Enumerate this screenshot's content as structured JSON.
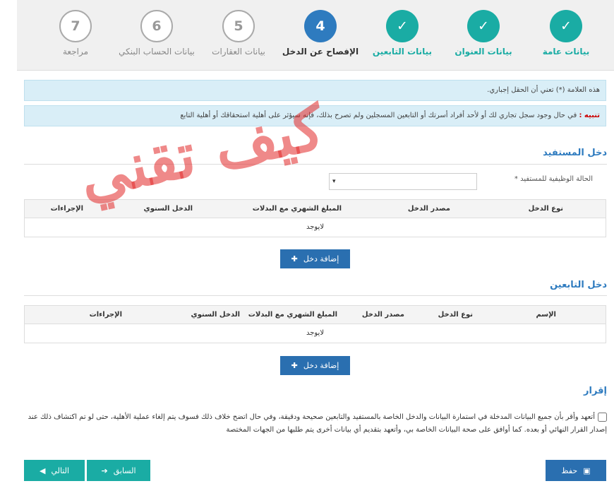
{
  "steps": [
    {
      "label": "بيانات عامة",
      "num": "✓",
      "state": "done"
    },
    {
      "label": "بيانات العنوان",
      "num": "✓",
      "state": "done"
    },
    {
      "label": "بيانات التابعين",
      "num": "✓",
      "state": "done"
    },
    {
      "label": "الإفصاح عن الدخل",
      "num": "4",
      "state": "cur"
    },
    {
      "label": "بيانات العقارات",
      "num": "5",
      "state": "todo"
    },
    {
      "label": "بيانات الحساب البنكي",
      "num": "6",
      "state": "todo"
    },
    {
      "label": "مراجعة",
      "num": "7",
      "state": "todo"
    }
  ],
  "notes": {
    "required": "هذه العلامة (*) تعني أن الحقل إجباري.",
    "warn_prefix": "تنبيه :",
    "warn_text": " في حال وجود سجل تجاري لك أو لأحد أفراد أسرتك أو التابعين المسجلين ولم تصرح بذلك، فإنه سيؤثر على أهلية استحقاقك أو أهلية التابع"
  },
  "beneficiary": {
    "title": "دخل المستفيد",
    "field_label": "الحالة الوظيفية للمستفيد *",
    "select_value": "▾",
    "columns": [
      "نوع الدخل",
      "مصدر الدخل",
      "المبلغ الشهري مع البدلات",
      "الدخل السنوي",
      "الإجراءات"
    ],
    "empty": "لايوجد",
    "add_label": "إضافة دخل"
  },
  "dependents": {
    "title": "دخل التابعين",
    "columns": [
      "الإسم",
      "نوع الدخل",
      "مصدر الدخل",
      "المبلغ الشهري مع البدلات",
      "الدخل السنوي",
      "الإجراءات"
    ],
    "empty": "لايوجد",
    "add_label": "إضافة دخل"
  },
  "declaration": {
    "title": "إقرار",
    "text": "أتعهد وأقر بأن جميع البيانات المدخلة في استمارة البيانات والدخل الخاصة بالمستفيد والتابعين صحيحة ودقيقة، وفي حال اتضح خلاف ذلك فسوف يتم إلغاء عملية الأهلية، حتى لو تم اكتشاف ذلك عند إصدار القرار النهائي أو بعده. كما أوافق على صحة البيانات الخاصة بي، وأتعهد بتقديم أي بيانات أخرى يتم طلبها من الجهات المختصة"
  },
  "footer": {
    "save": "حفظ",
    "prev": "السابق",
    "next": "التالي"
  },
  "watermark": "كيف تقني"
}
